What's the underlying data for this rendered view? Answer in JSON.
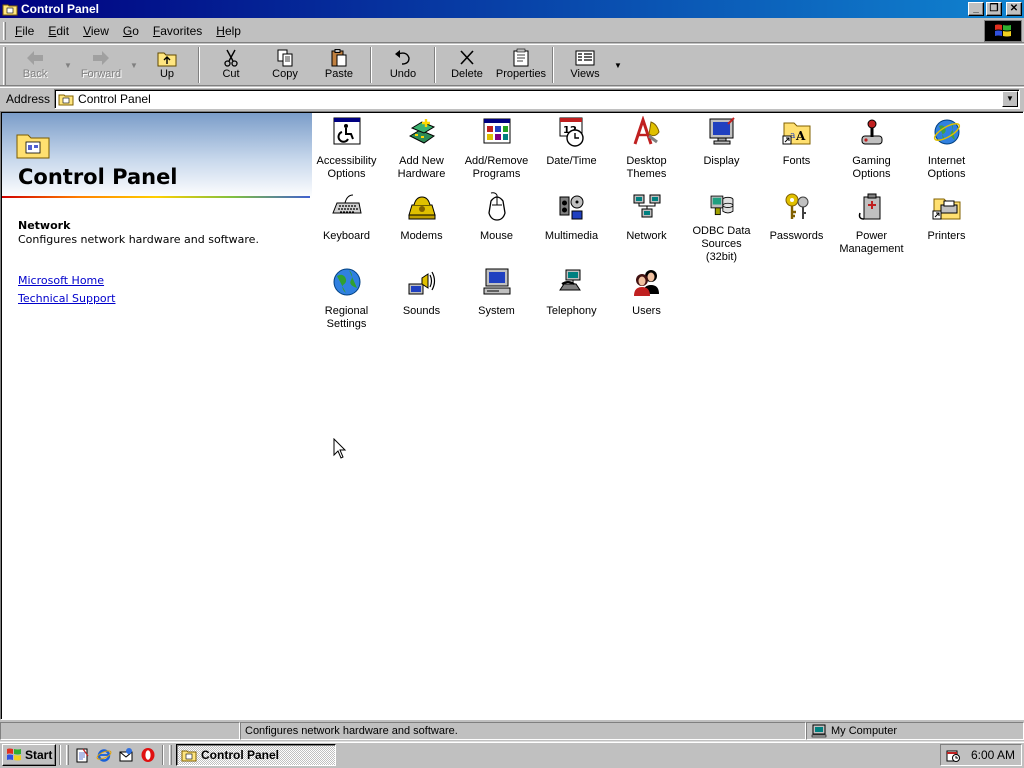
{
  "window": {
    "title": "Control Panel",
    "minimize": "_",
    "maximize": "❐",
    "close": "✕"
  },
  "menu": [
    "File",
    "Edit",
    "View",
    "Go",
    "Favorites",
    "Help"
  ],
  "toolbar": {
    "back": "Back",
    "forward": "Forward",
    "up": "Up",
    "cut": "Cut",
    "copy": "Copy",
    "paste": "Paste",
    "undo": "Undo",
    "delete": "Delete",
    "properties": "Properties",
    "views": "Views",
    "dropdown_arrow": "▼"
  },
  "address": {
    "label": "Address",
    "value": "Control Panel"
  },
  "left_pane": {
    "title": "Control Panel",
    "selected_name": "Network",
    "selected_description": "Configures network hardware and software.",
    "links": [
      "Microsoft Home",
      "Technical Support"
    ]
  },
  "items": [
    {
      "label": "Accessibility\nOptions",
      "icon": "accessibility-icon"
    },
    {
      "label": "Add New\nHardware",
      "icon": "add-hardware-icon"
    },
    {
      "label": "Add/Remove\nPrograms",
      "icon": "add-remove-programs-icon"
    },
    {
      "label": "Date/Time",
      "icon": "date-time-icon"
    },
    {
      "label": "Desktop\nThemes",
      "icon": "desktop-themes-icon"
    },
    {
      "label": "Display",
      "icon": "display-icon"
    },
    {
      "label": "Fonts",
      "icon": "fonts-icon"
    },
    {
      "label": "Gaming\nOptions",
      "icon": "gaming-options-icon"
    },
    {
      "label": "Internet\nOptions",
      "icon": "internet-options-icon"
    },
    {
      "label": "Keyboard",
      "icon": "keyboard-icon"
    },
    {
      "label": "Modems",
      "icon": "modems-icon"
    },
    {
      "label": "Mouse",
      "icon": "mouse-icon"
    },
    {
      "label": "Multimedia",
      "icon": "multimedia-icon"
    },
    {
      "label": "Network",
      "icon": "network-icon"
    },
    {
      "label": "ODBC Data\nSources (32bit)",
      "icon": "odbc-icon"
    },
    {
      "label": "Passwords",
      "icon": "passwords-icon"
    },
    {
      "label": "Power\nManagement",
      "icon": "power-management-icon"
    },
    {
      "label": "Printers",
      "icon": "printers-icon"
    },
    {
      "label": "Regional\nSettings",
      "icon": "regional-settings-icon"
    },
    {
      "label": "Sounds",
      "icon": "sounds-icon"
    },
    {
      "label": "System",
      "icon": "system-icon"
    },
    {
      "label": "Telephony",
      "icon": "telephony-icon"
    },
    {
      "label": "Users",
      "icon": "users-icon"
    }
  ],
  "status": {
    "left": "",
    "message": "Configures network hardware and software.",
    "zone": "My Computer"
  },
  "taskbar": {
    "start": "Start",
    "task": "Control Panel",
    "time": "6:00 AM"
  },
  "colors": {
    "titlebar": "#000080",
    "face": "#c0c0c0",
    "link": "#0000cc"
  }
}
